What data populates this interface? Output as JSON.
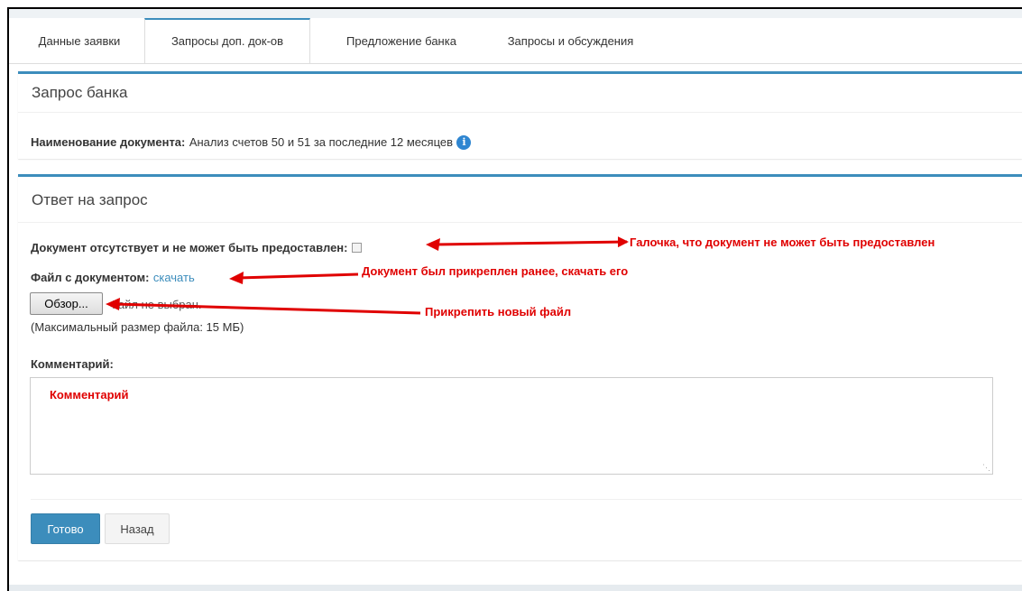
{
  "tabs": [
    {
      "label": "Данные заявки"
    },
    {
      "label": "Запросы доп. док-ов"
    },
    {
      "label": "Предложение банка"
    },
    {
      "label": "Запросы и обсуждения"
    }
  ],
  "bank_request": {
    "title": "Запрос банка",
    "doc_name_label": "Наименование документа:",
    "doc_name_value": "Анализ счетов 50 и 51 за последние 12 месяцев",
    "info_icon": "i"
  },
  "response": {
    "title": "Ответ на запрос",
    "missing_label": "Документ отсутствует и не может быть предоставлен:",
    "file_label": "Файл с документом:",
    "file_link": "скачать",
    "browse_button": "Обзор...",
    "file_status": "Файл не выбран.",
    "max_size": "(Максимальный размер файла: 15 МБ)",
    "comment_label": "Комментарий:"
  },
  "buttons": {
    "done": "Готово",
    "back": "Назад"
  },
  "annotations": {
    "checkbox_note": "Галочка, что документ не может быть предоставлен",
    "file_note": "Документ был прикреплен ранее, скачать его",
    "attach_note": "Прикрепить новый файл",
    "comment_note": "Комментарий"
  },
  "colors": {
    "accent": "#3c8dbc",
    "annotation": "#e00000"
  }
}
